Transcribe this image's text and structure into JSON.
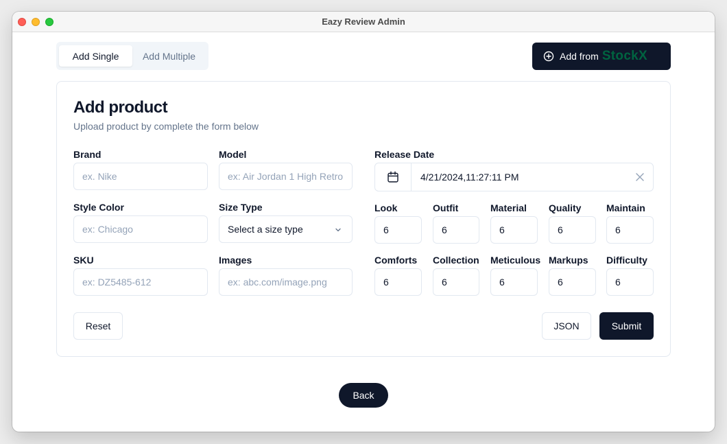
{
  "window": {
    "title": "Eazy Review Admin"
  },
  "tabs": {
    "single": "Add Single",
    "multiple": "Add Multiple"
  },
  "stockx_button": {
    "label": "Add from",
    "brand": "StockX"
  },
  "form": {
    "title": "Add product",
    "subtitle": "Upload product by complete the form below",
    "brand": {
      "label": "Brand",
      "placeholder": "ex. Nike"
    },
    "model": {
      "label": "Model",
      "placeholder": "ex: Air Jordan 1 High Retro"
    },
    "style_color": {
      "label": "Style Color",
      "placeholder": "ex: Chicago"
    },
    "size_type": {
      "label": "Size Type",
      "value": "Select a size type"
    },
    "sku": {
      "label": "SKU",
      "placeholder": "ex: DZ5485-612"
    },
    "images": {
      "label": "Images",
      "placeholder": "ex: abc.com/image.png"
    },
    "release_date": {
      "label": "Release Date",
      "value": "4/21/2024,11:27:11 PM"
    },
    "ratings": [
      {
        "label": "Look",
        "value": "6"
      },
      {
        "label": "Outfit",
        "value": "6"
      },
      {
        "label": "Material",
        "value": "6"
      },
      {
        "label": "Quality",
        "value": "6"
      },
      {
        "label": "Maintain",
        "value": "6"
      },
      {
        "label": "Comforts",
        "value": "6"
      },
      {
        "label": "Collection",
        "value": "6"
      },
      {
        "label": "Meticulous",
        "value": "6"
      },
      {
        "label": "Markups",
        "value": "6"
      },
      {
        "label": "Difficulty",
        "value": "6"
      }
    ],
    "reset": "Reset",
    "json": "JSON",
    "submit": "Submit"
  },
  "back": "Back"
}
